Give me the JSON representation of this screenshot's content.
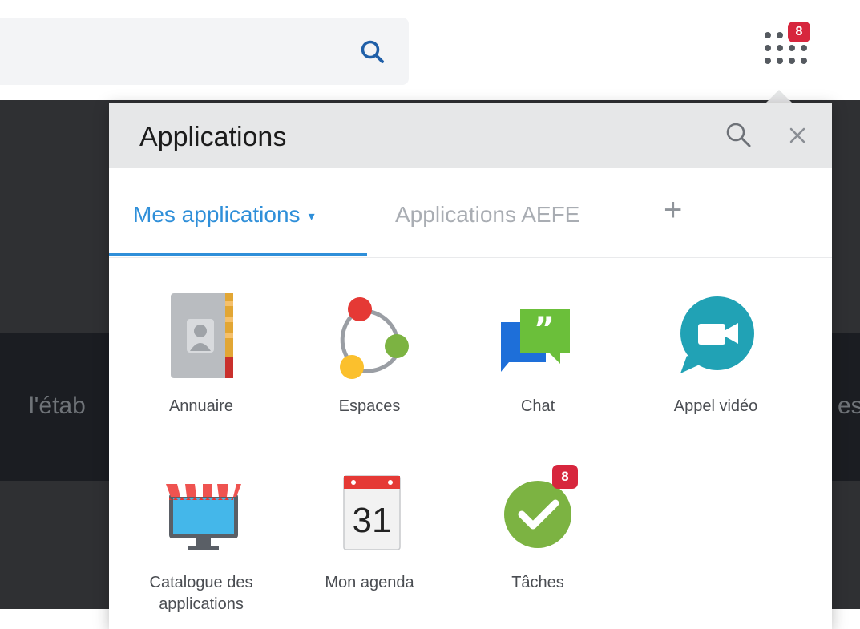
{
  "colors": {
    "accent": "#2f8fd9",
    "badge": "#d7263d",
    "header_bg": "#e6e7e8"
  },
  "topbar": {
    "search_icon": "search-icon",
    "launcher_icon": "grid-dots-icon",
    "launcher_badge": "8"
  },
  "background": {
    "left_text": "l'étab",
    "right_text": "es"
  },
  "popup": {
    "title": "Applications",
    "search_icon": "search-icon",
    "close_icon": "close-icon",
    "tabs": [
      {
        "label": "Mes applications",
        "active": true
      },
      {
        "label": "Applications AEFE",
        "active": false
      },
      {
        "label": "+",
        "active": false
      }
    ],
    "apps": [
      {
        "label": "Annuaire",
        "icon": "address-book-icon"
      },
      {
        "label": "Espaces",
        "icon": "spaces-icon"
      },
      {
        "label": "Chat",
        "icon": "chat-icon"
      },
      {
        "label": "Appel vidéo",
        "icon": "video-call-icon"
      },
      {
        "label": "Catalogue des applications",
        "icon": "catalog-store-icon"
      },
      {
        "label": "Mon agenda",
        "icon": "calendar-icon",
        "day": "31"
      },
      {
        "label": "Tâches",
        "icon": "tasks-check-icon",
        "badge": "8"
      }
    ]
  }
}
